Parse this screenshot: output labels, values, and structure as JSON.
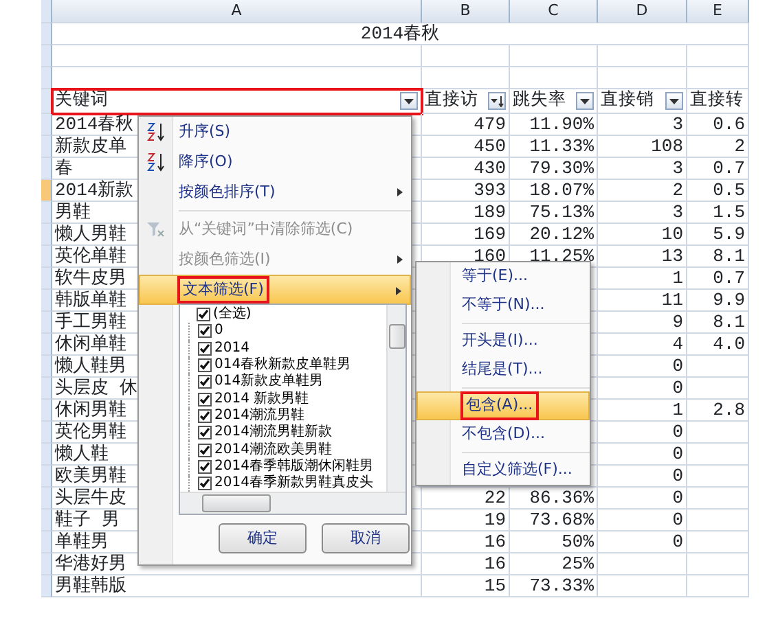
{
  "columns": [
    "A",
    "B",
    "C",
    "D",
    "E"
  ],
  "title": "2014春秋",
  "header": [
    {
      "label": "关键词",
      "kind": "filter",
      "outlined": true
    },
    {
      "label": "直接访",
      "kind": "sorted",
      "outlined": false
    },
    {
      "label": "跳失率",
      "kind": "filter",
      "outlined": false
    },
    {
      "label": "直接销",
      "kind": "filter",
      "outlined": false
    },
    {
      "label": "直接转",
      "kind": "none",
      "outlined": false
    }
  ],
  "rows": [
    {
      "keyword": "2014春秋",
      "visits": "479",
      "bounce": "11.90%",
      "sales": "3",
      "conversion": "0.6",
      "selected": false
    },
    {
      "keyword": "新款皮单",
      "visits": "450",
      "bounce": "11.33%",
      "sales": "108",
      "conversion": "2",
      "selected": false
    },
    {
      "keyword": "春",
      "visits": "430",
      "bounce": "79.30%",
      "sales": "3",
      "conversion": "0.7",
      "selected": false
    },
    {
      "keyword": "2014新款",
      "visits": "393",
      "bounce": "18.07%",
      "sales": "2",
      "conversion": "0.5",
      "selected": true
    },
    {
      "keyword": "男鞋",
      "visits": "189",
      "bounce": "75.13%",
      "sales": "3",
      "conversion": "1.5",
      "selected": false
    },
    {
      "keyword": "懒人男鞋",
      "visits": "169",
      "bounce": "20.12%",
      "sales": "10",
      "conversion": "5.9",
      "selected": false
    },
    {
      "keyword": "英伦单鞋",
      "visits": "160",
      "bounce": "11.25%",
      "sales": "13",
      "conversion": "8.1",
      "selected": false
    },
    {
      "keyword": "软牛皮男",
      "sales": "1",
      "conversion": "0.7",
      "selected": false
    },
    {
      "keyword": "韩版单鞋",
      "sales": "11",
      "conversion": "9.9",
      "selected": false
    },
    {
      "keyword": "手工男鞋",
      "sales": "9",
      "conversion": "8.1",
      "selected": false
    },
    {
      "keyword": "休闲单鞋",
      "sales": "4",
      "conversion": "4.0",
      "selected": false
    },
    {
      "keyword": "懒人鞋男",
      "sales": "0",
      "selected": false
    },
    {
      "keyword": "头层皮 休",
      "sales": "0",
      "selected": false
    },
    {
      "keyword": "休闲男鞋",
      "sales": "1",
      "conversion": "2.8",
      "selected": false
    },
    {
      "keyword": "英伦男鞋",
      "sales": "0",
      "selected": false
    },
    {
      "keyword": "懒人鞋",
      "sales": "0",
      "selected": false
    },
    {
      "keyword": "欧美男鞋",
      "sales": "0",
      "selected": false
    },
    {
      "keyword": "头层牛皮",
      "visits": "22",
      "bounce": "86.36%",
      "sales": "0",
      "selected": false
    },
    {
      "keyword": "鞋子 男",
      "visits": "19",
      "bounce": "73.68%",
      "sales": "0",
      "selected": false
    },
    {
      "keyword": "单鞋男",
      "visits": "16",
      "bounce": "50%",
      "sales": "0",
      "selected": false
    },
    {
      "keyword": "华港好男",
      "visits": "16",
      "bounce": "25%",
      "selected": false
    },
    {
      "keyword": "男鞋韩版",
      "visits": "15",
      "bounce": "73.33%",
      "selected": false
    }
  ],
  "filter_menu": {
    "items": [
      {
        "label": "升序(S)",
        "kind": "sort-asc",
        "disabled": false,
        "submenu": false,
        "highlighted": false,
        "divider_after": false
      },
      {
        "label": "降序(O)",
        "kind": "sort-desc",
        "disabled": false,
        "submenu": false,
        "highlighted": false,
        "divider_after": false
      },
      {
        "label": "按颜色排序(T)",
        "kind": "item",
        "disabled": false,
        "submenu": true,
        "highlighted": false,
        "divider_after": true
      },
      {
        "label": "从“关键词”中清除筛选(C)",
        "kind": "clear",
        "disabled": true,
        "submenu": false,
        "highlighted": false,
        "divider_after": false
      },
      {
        "label": "按颜色筛选(I)",
        "kind": "item",
        "disabled": true,
        "submenu": true,
        "highlighted": false,
        "divider_after": false
      },
      {
        "label": "文本筛选(F)",
        "kind": "item",
        "disabled": false,
        "submenu": true,
        "highlighted": true,
        "divider_after": false
      }
    ],
    "values": [
      {
        "label": "(全选)",
        "checked": true
      },
      {
        "label": "0",
        "checked": true
      },
      {
        "label": "2014",
        "checked": true
      },
      {
        "label": "014春秋新款皮单鞋男",
        "checked": true
      },
      {
        "label": "014新款皮单鞋男",
        "checked": true
      },
      {
        "label": "2014  新款男鞋",
        "checked": true
      },
      {
        "label": "2014潮流男鞋",
        "checked": true
      },
      {
        "label": "2014潮流男鞋新款",
        "checked": true
      },
      {
        "label": "2014潮流欧美男鞋",
        "checked": true
      },
      {
        "label": "2014春季韩版潮休闲鞋男",
        "checked": true
      },
      {
        "label": "2014春季新款男鞋真皮头",
        "checked": true
      }
    ],
    "buttons": [
      "确定",
      "取消"
    ]
  },
  "text_filter_menu": {
    "items": [
      {
        "label": "等于(E)...",
        "highlighted": false,
        "divider_after": false
      },
      {
        "label": "不等于(N)...",
        "highlighted": false,
        "divider_after": true
      },
      {
        "label": "开头是(I)...",
        "highlighted": false,
        "divider_after": false
      },
      {
        "label": "结尾是(T)...",
        "highlighted": false,
        "divider_after": true
      },
      {
        "label": "包含(A)...",
        "highlighted": true,
        "divider_after": false
      },
      {
        "label": "不包含(D)...",
        "highlighted": false,
        "divider_after": true
      },
      {
        "label": "自定义筛选(F)...",
        "highlighted": false,
        "divider_after": false
      }
    ]
  }
}
